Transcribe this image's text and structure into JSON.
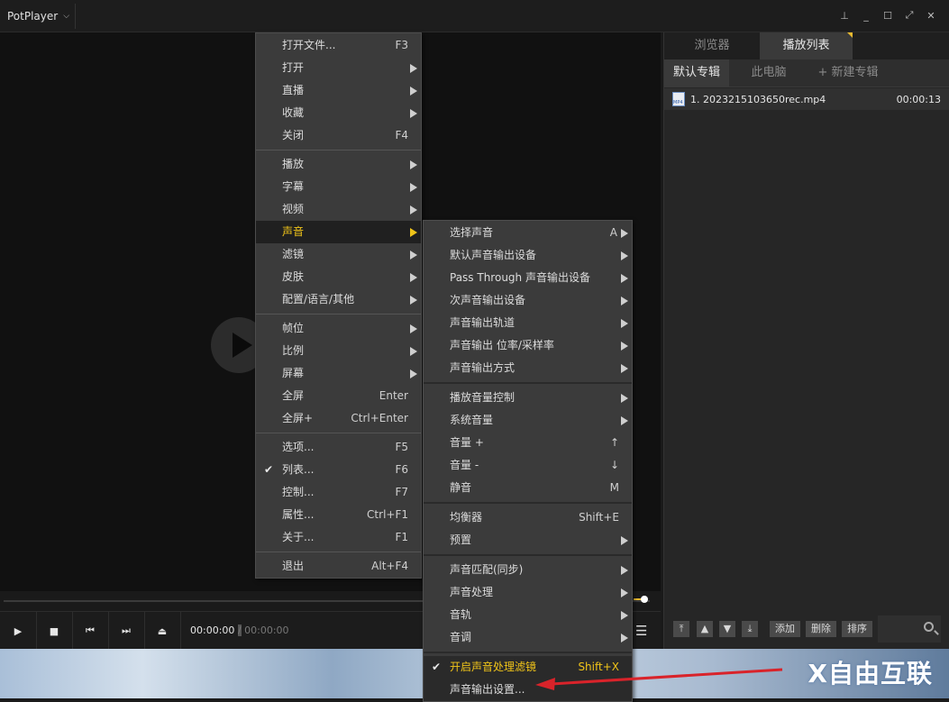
{
  "app": {
    "title": "PotPlayer"
  },
  "window_controls": [
    "pin-icon",
    "minimize-icon",
    "maximize-icon",
    "fullscreen-icon",
    "close-icon"
  ],
  "controls": {
    "time_current": "00:00:00",
    "time_sep": "/",
    "time_total": "00:00:00"
  },
  "panel": {
    "tabs": [
      "浏览器",
      "播放列表"
    ],
    "albums": [
      "默认专辑",
      "此电脑",
      "+ 新建专辑"
    ],
    "items": [
      {
        "name": "1. 2023215103650rec.mp4",
        "duration": "00:00:13"
      }
    ],
    "buttons": {
      "add": "添加",
      "delete": "删除",
      "sort": "排序"
    }
  },
  "main_menu": [
    {
      "label": "打开文件...",
      "shortcut": "F3"
    },
    {
      "label": "打开",
      "submenu": true
    },
    {
      "label": "直播",
      "submenu": true
    },
    {
      "label": "收藏",
      "submenu": true
    },
    {
      "label": "关闭",
      "shortcut": "F4"
    },
    {
      "label": "播放",
      "submenu": true
    },
    {
      "label": "字幕",
      "submenu": true
    },
    {
      "label": "视频",
      "submenu": true
    },
    {
      "label": "声音",
      "submenu": true,
      "highlighted": true
    },
    {
      "label": "滤镜",
      "submenu": true
    },
    {
      "label": "皮肤",
      "submenu": true
    },
    {
      "label": "配置/语言/其他",
      "submenu": true
    },
    {
      "label": "帧位",
      "submenu": true
    },
    {
      "label": "比例",
      "submenu": true
    },
    {
      "label": "屏幕",
      "submenu": true
    },
    {
      "label": "全屏",
      "shortcut": "Enter"
    },
    {
      "label": "全屏+",
      "shortcut": "Ctrl+Enter"
    },
    {
      "label": "选项...",
      "shortcut": "F5"
    },
    {
      "label": "列表...",
      "shortcut": "F6",
      "checked": true
    },
    {
      "label": "控制...",
      "shortcut": "F7"
    },
    {
      "label": "属性...",
      "shortcut": "Ctrl+F1"
    },
    {
      "label": "关于...",
      "shortcut": "F1"
    },
    {
      "label": "退出",
      "shortcut": "Alt+F4"
    }
  ],
  "sound_menu": [
    {
      "label": "选择声音",
      "shortcut": "A",
      "submenu": true
    },
    {
      "label": "默认声音输出设备",
      "submenu": true
    },
    {
      "label": "Pass Through 声音输出设备",
      "submenu": true
    },
    {
      "label": "次声音输出设备",
      "submenu": true
    },
    {
      "label": "声音输出轨道",
      "submenu": true
    },
    {
      "label": "声音输出 位率/采样率",
      "submenu": true
    },
    {
      "label": "声音输出方式",
      "submenu": true
    },
    {
      "label": "播放音量控制",
      "submenu": true
    },
    {
      "label": "系统音量",
      "submenu": true
    },
    {
      "label": "音量 +",
      "shortcut": "↑"
    },
    {
      "label": "音量 -",
      "shortcut": "↓"
    },
    {
      "label": "静音",
      "shortcut": "M"
    },
    {
      "label": "均衡器",
      "shortcut": "Shift+E"
    },
    {
      "label": "预置",
      "submenu": true
    },
    {
      "label": "声音匹配(同步)",
      "submenu": true
    },
    {
      "label": "声音处理",
      "submenu": true
    },
    {
      "label": "音轨",
      "submenu": true
    },
    {
      "label": "音调",
      "submenu": true
    },
    {
      "label": "开启声音处理滤镜",
      "shortcut": "Shift+X",
      "checked": true
    },
    {
      "label": "声音输出设置..."
    }
  ],
  "watermark": "X自由互联",
  "colors": {
    "accent": "#f0c419",
    "menu_bg": "#3b3b3b",
    "annotation_arrow": "#d9232a"
  }
}
